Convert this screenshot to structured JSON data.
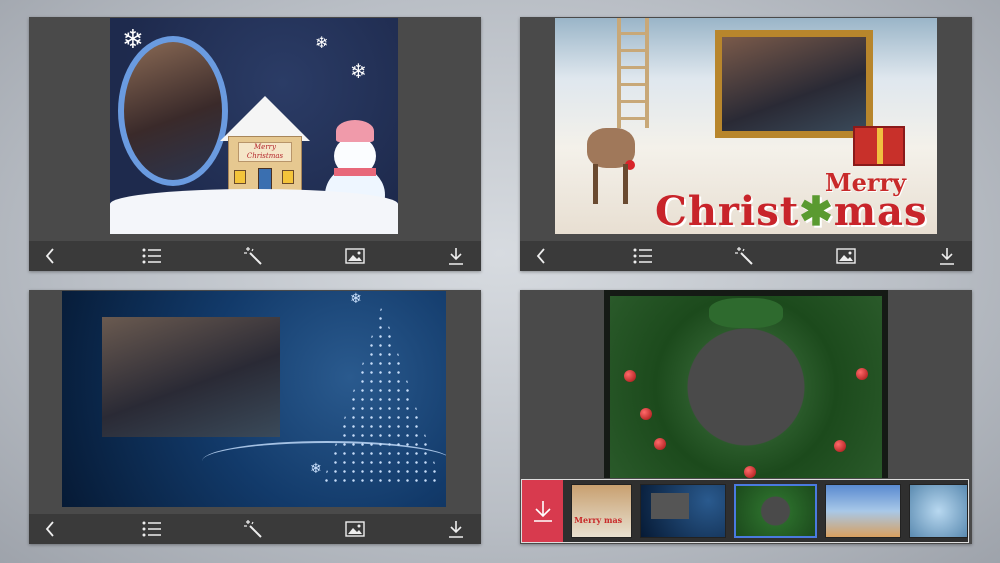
{
  "cards": [
    {
      "text_merry": "Merry",
      "text_christmas": "Christmas"
    },
    {
      "text_merry": "Merry",
      "text_christ": "Christ",
      "text_mas": "mas"
    },
    {},
    {}
  ],
  "toolbar": {
    "back_icon": "chevron-left-icon",
    "list_icon": "list-icon",
    "magic_icon": "magic-wand-icon",
    "image_icon": "image-icon",
    "download_icon": "download-icon"
  },
  "thumbnail_strip": {
    "download_icon": "download-icon",
    "thumb1_text": "Merry mas",
    "selected_index": 3,
    "accent": "#d83a4e",
    "selected_border": "#4a7ae0"
  }
}
